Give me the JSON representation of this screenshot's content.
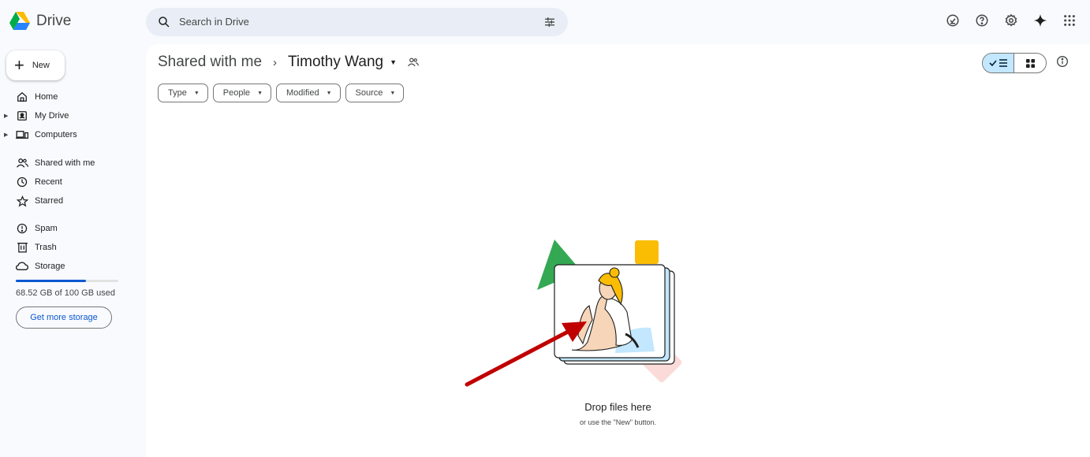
{
  "app": {
    "name": "Drive"
  },
  "search": {
    "placeholder": "Search in Drive"
  },
  "sidebar": {
    "new_label": "New",
    "items": [
      {
        "label": "Home"
      },
      {
        "label": "My Drive"
      },
      {
        "label": "Computers"
      },
      {
        "label": "Shared with me"
      },
      {
        "label": "Recent"
      },
      {
        "label": "Starred"
      },
      {
        "label": "Spam"
      },
      {
        "label": "Trash"
      },
      {
        "label": "Storage"
      }
    ],
    "storage_used_fraction": 0.6852,
    "storage_text": "68.52 GB of 100 GB used",
    "get_storage_label": "Get more storage"
  },
  "breadcrumb": {
    "root": "Shared with me",
    "separator": "›",
    "current": "Timothy Wang"
  },
  "filters": [
    {
      "label": "Type"
    },
    {
      "label": "People"
    },
    {
      "label": "Modified"
    },
    {
      "label": "Source"
    }
  ],
  "empty_state": {
    "title": "Drop files here",
    "subtitle": "or use the \"New\" button."
  },
  "colors": {
    "accent": "#0b57d0",
    "selected": "#c2e7ff",
    "annotation_arrow": "#c00000"
  }
}
